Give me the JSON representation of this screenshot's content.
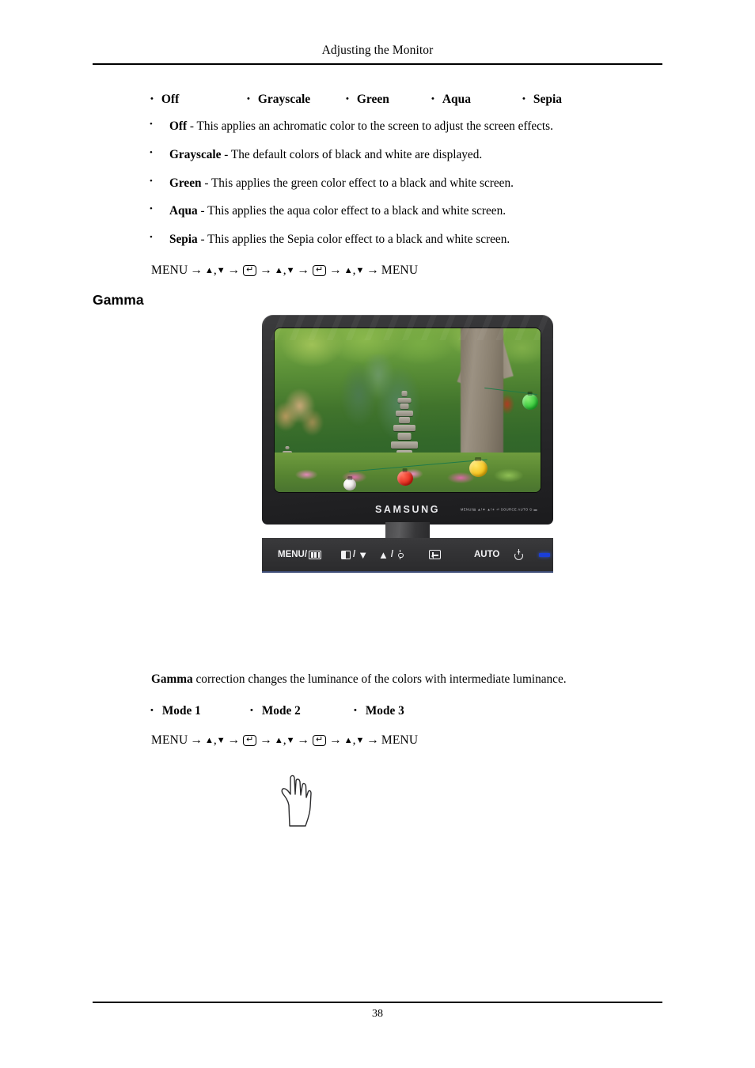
{
  "document": {
    "header_title": "Adjusting the Monitor",
    "page_number": "38"
  },
  "color_effect_options": {
    "items": [
      {
        "label": "Off"
      },
      {
        "label": "Grayscale"
      },
      {
        "label": "Green"
      },
      {
        "label": "Aqua"
      },
      {
        "label": "Sepia"
      }
    ],
    "bullet_char": "•"
  },
  "color_effect_descriptions": [
    {
      "term": "Off",
      "text": " - This applies an achromatic color to the screen to adjust the screen effects."
    },
    {
      "term": "Grayscale",
      "text": " - The default colors of black and white are displayed."
    },
    {
      "term": "Green",
      "text": " - This applies the green color effect to a black and white screen."
    },
    {
      "term": "Aqua",
      "text": " - This applies the aqua color effect to a black and white screen."
    },
    {
      "term": "Sepia",
      "text": " - This applies the Sepia color effect to a black and white screen."
    }
  ],
  "nav_sequence": {
    "start_label": "MENU",
    "end_label": "MENU",
    "arrow": "→",
    "up_triangle": "▲",
    "down_triangle": "▼",
    "comma": ",",
    "enter_key": "↵"
  },
  "gamma_section": {
    "title": "Gamma",
    "description_term": "Gamma",
    "description_text": " correction changes the luminance of the colors with intermediate luminance.",
    "modes": [
      {
        "label": "Mode 1"
      },
      {
        "label": "Mode 2"
      },
      {
        "label": "Mode 3"
      }
    ]
  },
  "monitor_figure": {
    "brand": "SAMSUNG",
    "bezel_hints": "MENU/▤  ▲/▼  ▲/☀  ⏎ SOURCE  AUTO  ⏻  ▬",
    "controls": [
      {
        "name": "menu-button",
        "label": "MENU/",
        "icon": "menu-bars-icon"
      },
      {
        "name": "contrast-down-button",
        "label": "/",
        "icon": "contrast-icon",
        "trailing_icon": "triangle-down-icon",
        "trailing": "▼"
      },
      {
        "name": "brightness-up-button",
        "label": "/",
        "icon": "triangle-up-icon",
        "leading": "▲",
        "trailing_icon": "brightness-icon"
      },
      {
        "name": "source-enter-button",
        "label": "",
        "icon": "enter-source-icon"
      },
      {
        "name": "auto-button",
        "label": "AUTO",
        "icon": ""
      },
      {
        "name": "power-button",
        "label": "",
        "icon": "power-icon"
      },
      {
        "name": "power-led",
        "label": "",
        "icon": "led-indicator",
        "color": "#1b3fd8"
      }
    ],
    "screen_scene": {
      "description": "Korean garden with stone pagoda, conifers, flowering tree and paper lanterns",
      "lanterns": [
        {
          "name": "lantern-red",
          "color": "#dd1d10"
        },
        {
          "name": "lantern-white",
          "color": "#ffffff"
        },
        {
          "name": "lantern-yellow",
          "color": "#f2b808"
        },
        {
          "name": "lantern-green",
          "color": "#1fbd2c"
        }
      ]
    }
  }
}
